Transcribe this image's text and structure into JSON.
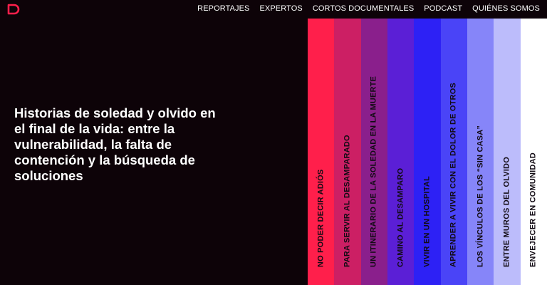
{
  "topbar": {
    "logo_icon": "brand-logo-icon",
    "nav": [
      {
        "label": "REPORTAJES"
      },
      {
        "label": "EXPERTOS"
      },
      {
        "label": "CORTOS DOCUMENTALES"
      },
      {
        "label": "PODCAST"
      },
      {
        "label": "QUIÉNES SOMOS"
      }
    ]
  },
  "hero": {
    "headline": "Historias de soledad y olvido en el final de la vida: entre la vulnerabilidad, la falta de contención y la búsqueda de soluciones"
  },
  "stories": [
    {
      "label": "NO PODER DECIR ADIÓS",
      "color": "#ff1f4b"
    },
    {
      "label": "PARA SERVIR AL DESAMPARADO",
      "color": "#cc1f64"
    },
    {
      "label": "UN ITINERARIO DE LA SOLEDAD EN LA MUERTE",
      "color": "#8a1f8c"
    },
    {
      "label": "CAMINO AL DESAMPARO",
      "color": "#5b1fd6"
    },
    {
      "label": "VIVIR EN UN HOSPITAL",
      "color": "#2d21f5"
    },
    {
      "label": "APRENDER A VIVIR CON EL DOLOR DE OTROS",
      "color": "#4a44f7"
    },
    {
      "label": "LOS VÍNCULOS DE LOS “SIN CASA”",
      "color": "#8685f9"
    },
    {
      "label": "ENTRE MUROS DEL OLVIDO",
      "color": "#bcbcfb"
    },
    {
      "label": "ENVEJECER EN COMUNIDAD",
      "color": "#ffffff"
    }
  ],
  "colors": {
    "background": "#0d0308",
    "brand": "#ff1f4b",
    "text": "#ffffff",
    "strip_text": "#120b14"
  }
}
